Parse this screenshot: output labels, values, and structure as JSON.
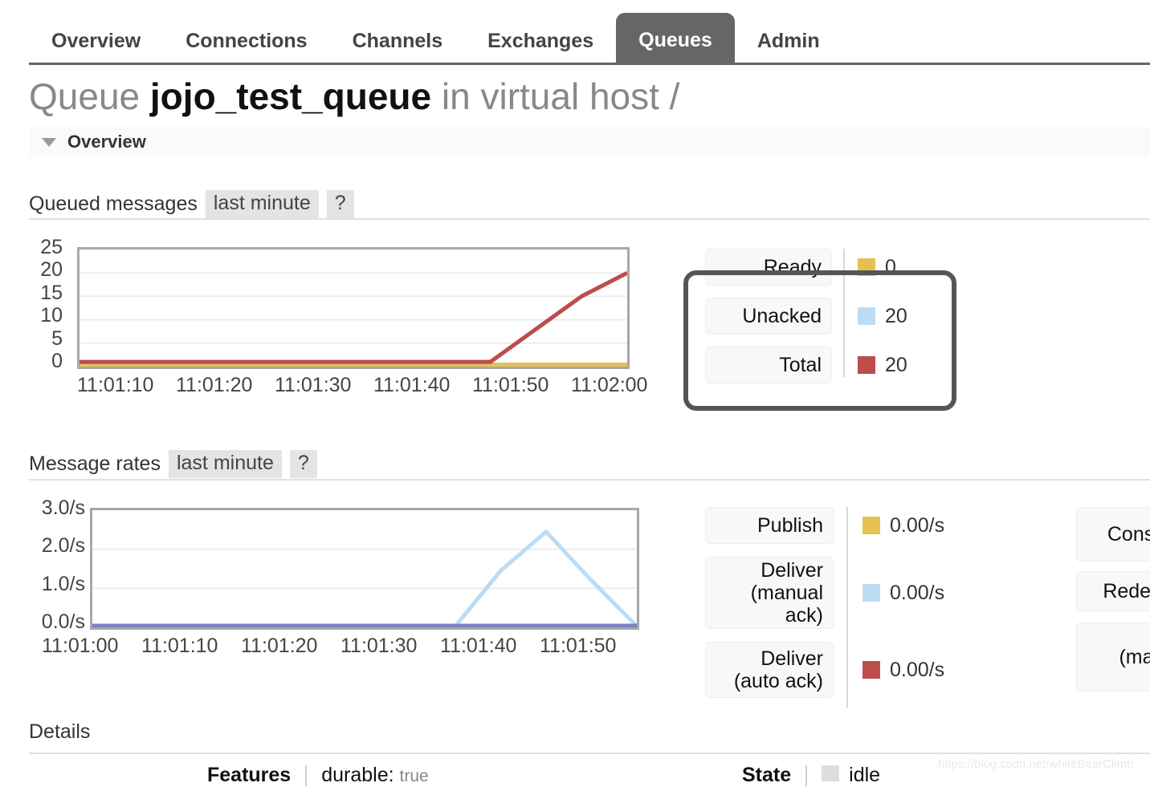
{
  "nav": {
    "tabs": [
      {
        "label": "Overview",
        "active": false
      },
      {
        "label": "Connections",
        "active": false
      },
      {
        "label": "Channels",
        "active": false
      },
      {
        "label": "Exchanges",
        "active": false
      },
      {
        "label": "Queues",
        "active": true
      },
      {
        "label": "Admin",
        "active": false
      }
    ]
  },
  "page": {
    "title_prefix": "Queue ",
    "title_name": "jojo_test_queue",
    "title_suffix": " in virtual host /",
    "overview_section": "Overview",
    "details_section": "Details"
  },
  "queued_messages": {
    "label": "Queued messages",
    "period_chip": "last minute",
    "help_chip": "?",
    "legend": [
      {
        "name": "Ready",
        "value": "0",
        "color": "#e5c153"
      },
      {
        "name": "Unacked",
        "value": "20",
        "color": "#bcdcf4"
      },
      {
        "name": "Total",
        "value": "20",
        "color": "#bd4c4c"
      }
    ]
  },
  "message_rates": {
    "label": "Message rates",
    "period_chip": "last minute",
    "help_chip": "?",
    "legend_left": [
      {
        "name": "Publish",
        "value": "0.00/s",
        "color": "#e5c153"
      },
      {
        "name": "Deliver\n(manual\nack)",
        "value": "0.00/s",
        "color": "#bcdcf4"
      },
      {
        "name": "Deliver\n(auto ack)",
        "value": "0.00/s",
        "color": "#bd4c4c"
      }
    ],
    "legend_right": [
      {
        "name": "Consu"
      },
      {
        "name": "Redeliv"
      },
      {
        "name": "(ma"
      }
    ]
  },
  "details": {
    "features_key": "Features",
    "features_val": "durable:",
    "features_val_dim": "true",
    "state_key": "State",
    "state_val": "idle"
  },
  "watermark": "https://blog.csdn.net/whiteBearClimb",
  "chart_data": [
    {
      "type": "line",
      "title": "Queued messages",
      "xlabel": "",
      "ylabel": "",
      "ylim": [
        0,
        25
      ],
      "yticks": [
        25,
        20,
        15,
        10,
        5,
        0
      ],
      "xticks": [
        "11:01:10",
        "11:01:20",
        "11:01:30",
        "11:01:40",
        "11:01:50",
        "11:02:00"
      ],
      "grid": true,
      "legend_position": "right",
      "x": [
        0,
        10,
        20,
        30,
        40,
        45,
        50,
        55,
        60
      ],
      "series": [
        {
          "name": "Ready",
          "color": "#e5c153",
          "values": [
            0,
            0,
            0,
            0,
            0,
            0,
            0,
            0,
            0
          ]
        },
        {
          "name": "Unacked",
          "color": "#bcdcf4",
          "values": [
            1,
            1,
            1,
            1,
            1,
            1,
            8,
            15,
            20
          ]
        },
        {
          "name": "Total",
          "color": "#bd4c4c",
          "values": [
            1,
            1,
            1,
            1,
            1,
            1,
            8,
            15,
            20
          ]
        }
      ]
    },
    {
      "type": "line",
      "title": "Message rates",
      "xlabel": "",
      "ylabel": "",
      "ylim": [
        0,
        3.0
      ],
      "yticks": [
        "3.0/s",
        "2.0/s",
        "1.0/s",
        "0.0/s"
      ],
      "xticks": [
        "11:01:00",
        "11:01:10",
        "11:01:20",
        "11:01:30",
        "11:01:40",
        "11:01:50"
      ],
      "grid": true,
      "legend_position": "right",
      "x": [
        0,
        10,
        20,
        30,
        40,
        45,
        50,
        55,
        60
      ],
      "series": [
        {
          "name": "Deliver (manual ack)",
          "color": "#bcdcf4",
          "values": [
            0,
            0,
            0,
            0,
            0,
            1.45,
            2.45,
            1.2,
            0
          ]
        },
        {
          "name": "Publish",
          "color": "#7b7fc4",
          "values": [
            0,
            0,
            0,
            0,
            0,
            0,
            0,
            0,
            0
          ]
        }
      ]
    }
  ]
}
